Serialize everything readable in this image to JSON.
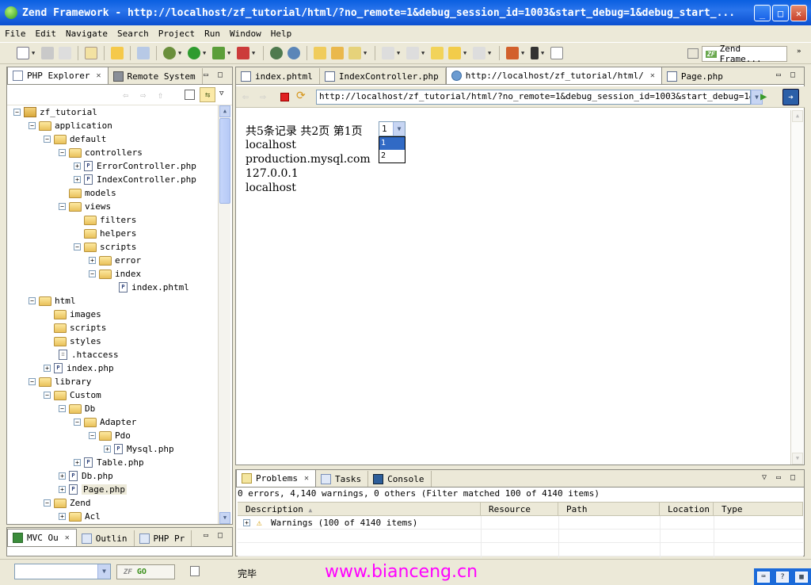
{
  "window": {
    "title": "Zend Framework - http://localhost/zf_tutorial/html/?no_remote=1&debug_session_id=1003&start_debug=1&debug_start_..."
  },
  "menu": [
    "File",
    "Edit",
    "Navigate",
    "Search",
    "Project",
    "Run",
    "Window",
    "Help"
  ],
  "toolbar": {
    "perspective_label": "Zend Frame..."
  },
  "left_tabs": {
    "php_explorer": "PHP Explorer",
    "remote_system": "Remote System"
  },
  "tree": [
    "zf_tutorial",
    "application",
    "default",
    "controllers",
    "ErrorController.php",
    "IndexController.php",
    "models",
    "views",
    "filters",
    "helpers",
    "scripts",
    "error",
    "index",
    "index.phtml",
    "html",
    "images",
    "scripts",
    "styles",
    ".htaccess",
    "index.php",
    "library",
    "Custom",
    "Db",
    "Adapter",
    "Pdo",
    "Mysql.php",
    "Table.php",
    "Db.php",
    "Page.php",
    "Zend",
    "Acl"
  ],
  "bottom_left_tabs": [
    "MVC Ou",
    "Outlin",
    "PHP Pr"
  ],
  "editor_tabs": [
    "index.phtml",
    "IndexController.php",
    "http://localhost/zf_tutorial/html/",
    "Page.php"
  ],
  "browser": {
    "url": "http://localhost/zf_tutorial/html/?no_remote=1&debug_session_id=1003&start_debug=1&debug",
    "content": {
      "summary": "共5条记录 共2页 第1页",
      "lines": [
        "localhost",
        "production.mysql.com",
        "127.0.0.1",
        "localhost"
      ],
      "select_value": "1",
      "options": [
        "1",
        "2"
      ]
    }
  },
  "bottom_tabs": {
    "problems": "Problems",
    "tasks": "Tasks",
    "console": "Console"
  },
  "problems": {
    "summary": "0 errors, 4,140 warnings, 0 others (Filter matched 100 of 4140 items)",
    "columns": [
      "Description",
      "Resource",
      "Path",
      "Location",
      "Type"
    ],
    "rows": [
      "Warnings (100 of 4140 items)"
    ]
  },
  "statusbar": {
    "go_label": "GO",
    "status_text": "完毕",
    "watermark": "www.bianceng.cn"
  },
  "icons": {
    "colors": {
      "zend_green": "#6aa84f",
      "selection": "#316ac5",
      "watermark": "#ff00ff",
      "title_blue": "#0a5fe0"
    }
  }
}
